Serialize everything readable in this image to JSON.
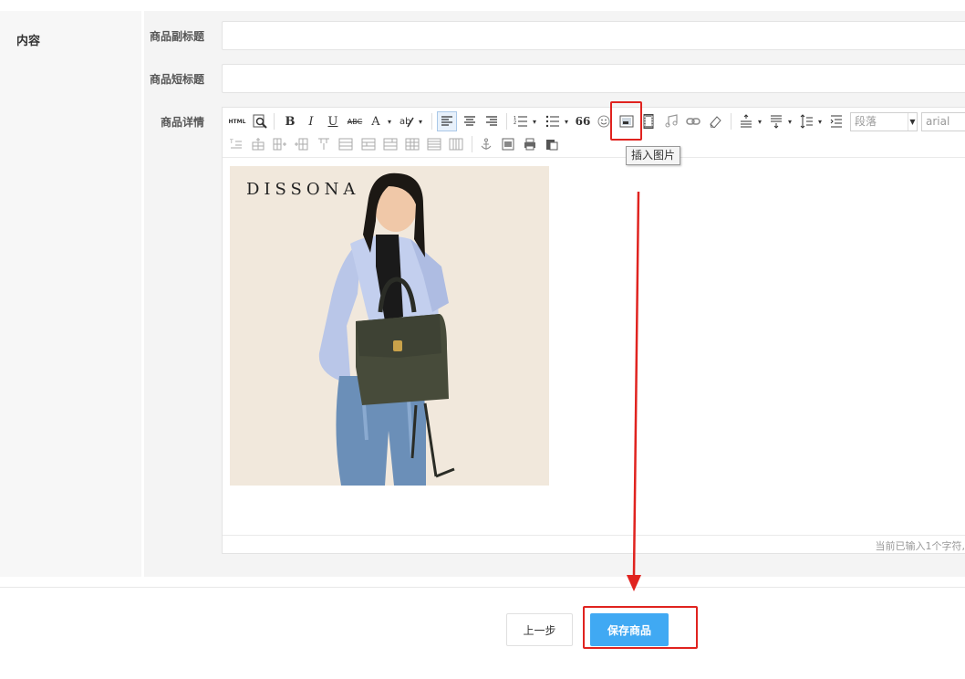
{
  "section": {
    "label": "内容"
  },
  "fields": {
    "subtitle_label": "商品副标题",
    "short_title_label": "商品短标题",
    "detail_label": "商品详情"
  },
  "toolbar": {
    "html_label": "HTML",
    "bold": "B",
    "italic": "I",
    "underline": "U",
    "strike": "ABC",
    "font_color": "A",
    "quote": "66",
    "paragraph_select": "段落",
    "font_select": "arial"
  },
  "tooltip": "插入图片",
  "editor": {
    "brand_text": "DISSONA",
    "status_text": "当前已输入1个字符,"
  },
  "buttons": {
    "prev": "上一步",
    "save": "保存商品"
  },
  "colors": {
    "accent": "#40a9f3",
    "highlight": "#e0231f"
  }
}
